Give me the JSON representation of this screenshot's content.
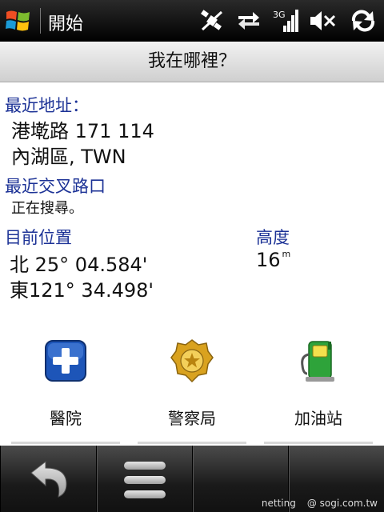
{
  "status_bar": {
    "title": "開始",
    "icons": [
      "windows-logo-icon",
      "gps-satellite-icon",
      "data-transfer-icon",
      "signal-3g-icon",
      "speaker-muted-icon",
      "sync-icon"
    ],
    "network_label": "3G"
  },
  "title_bar": {
    "title": "我在哪裡？"
  },
  "recent_address": {
    "label": "最近地址：",
    "line1": "港墘路 171 114",
    "line2": "內湖區, TWN"
  },
  "cross_street": {
    "label": "最近交叉路口",
    "value": "正在搜尋。"
  },
  "position": {
    "label": "目前位置",
    "lat": "北 25° 04.584'",
    "lon": "東121° 34.498'"
  },
  "altitude": {
    "label": "高度",
    "value": "16",
    "unit": "m"
  },
  "quick_buttons": [
    {
      "label": "醫院",
      "icon": "hospital-cross-icon",
      "color": "#1d55b8"
    },
    {
      "label": "警察局",
      "icon": "police-badge-icon",
      "color": "#d9a21f"
    },
    {
      "label": "加油站",
      "icon": "fuel-pump-icon",
      "color": "#2ea33a"
    }
  ],
  "bottom_bar": {
    "icons": [
      "back-arrow-icon",
      "menu-icon"
    ],
    "watermark_user": "netting",
    "watermark_site": "@ sogi.com.tw"
  },
  "colors": {
    "label_blue": "#1c3296",
    "status_bg": "#000000"
  }
}
